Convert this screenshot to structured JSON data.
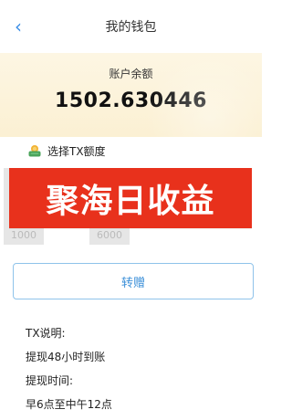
{
  "header": {
    "title": "我的钱包"
  },
  "wallet": {
    "balance_label": "账户余额",
    "balance_value": "1502.630446"
  },
  "tx_section": {
    "title": "选择TX额度",
    "amount_options": [
      "1000",
      "6000"
    ]
  },
  "banner": {
    "text": "聚海日收益"
  },
  "actions": {
    "transfer_label": "转赠"
  },
  "notes": {
    "lines": [
      "TX说明:",
      "提现48小时到账",
      "提现时间:",
      "早6点至中午12点"
    ]
  },
  "colors": {
    "accent": "#3b8fd8",
    "banner_bg": "#e8311c",
    "card_bg": "#fbf0d3"
  }
}
